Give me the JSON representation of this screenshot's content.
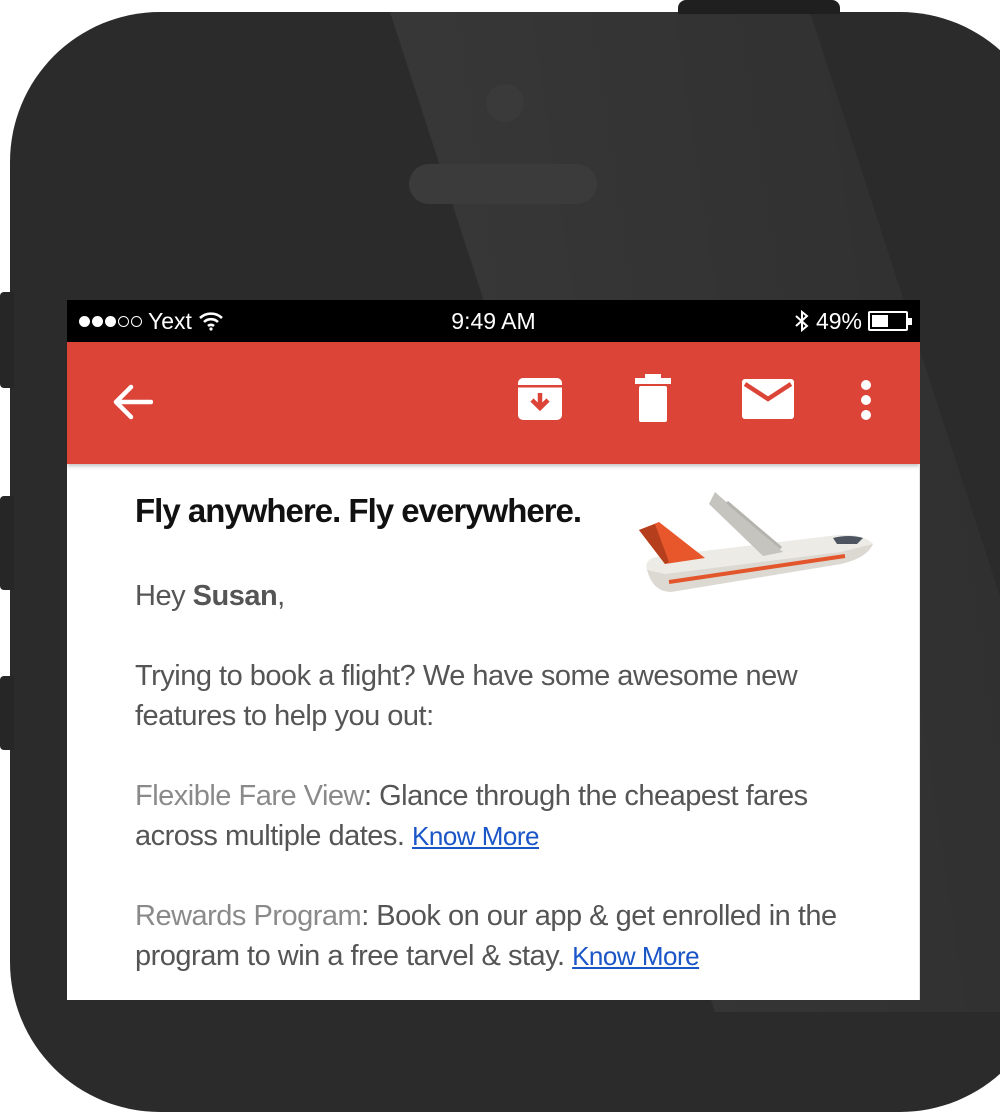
{
  "status_bar": {
    "carrier": "Yext",
    "time": "9:49 AM",
    "battery_percent": "49%",
    "battery_level": 0.49
  },
  "toolbar": {
    "color": "#db4437",
    "icons": [
      "back-arrow-icon",
      "archive-icon",
      "trash-icon",
      "mail-icon",
      "more-vert-icon"
    ]
  },
  "email": {
    "headline": "Fly anywhere. Fly everywhere.",
    "greeting_prefix": "Hey ",
    "greeting_name": "Susan",
    "greeting_suffix": ",",
    "intro": "Trying to book a flight? We have some awesome new features to help you out:",
    "features": [
      {
        "name": "Flexible Fare View",
        "description": ": Glance through the cheapest fares across multiple dates. ",
        "link": "Know More"
      },
      {
        "name": "Rewards Program",
        "description": ": Book on our app & get enrolled in the program to win a free tarvel & stay. ",
        "link": "Know More"
      }
    ]
  },
  "colors": {
    "accent_red": "#db4437",
    "link_blue": "#1a56c7",
    "phone_body": "#2b2b2b"
  }
}
